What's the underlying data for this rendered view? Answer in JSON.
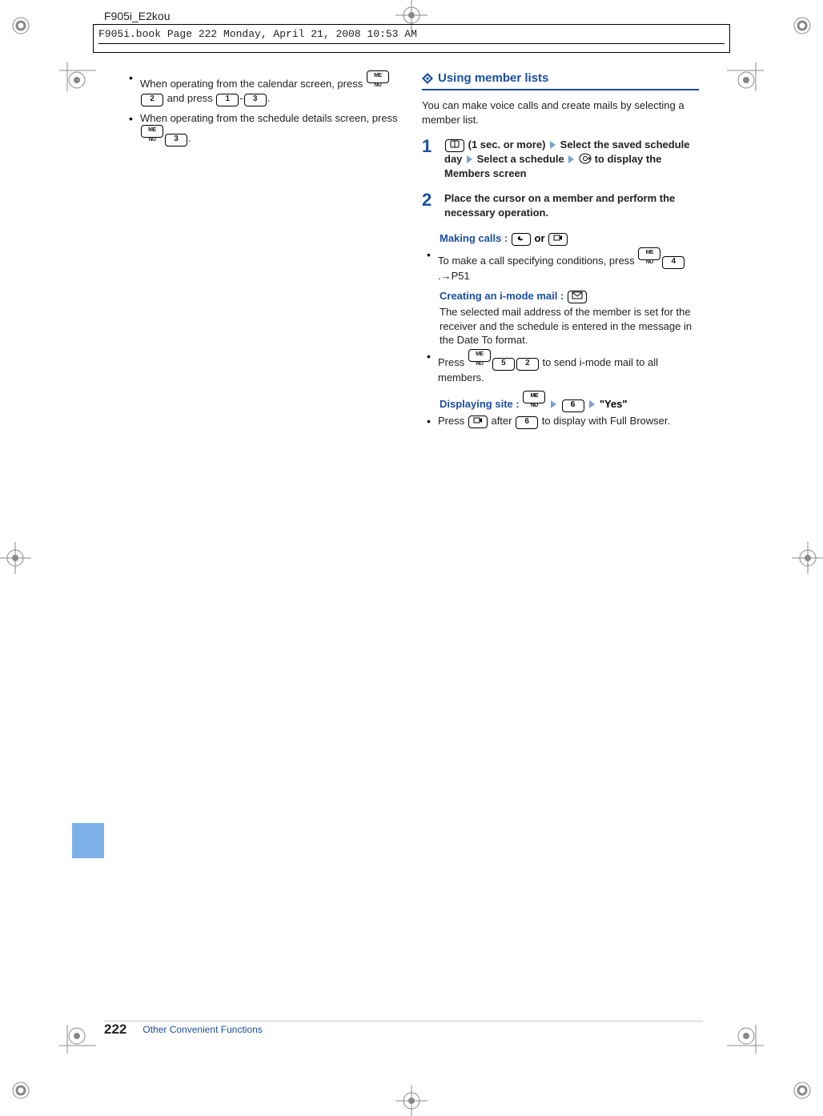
{
  "meta": {
    "doc_header": "F905i_E2kou",
    "framemaker": "F905i.book  Page 222  Monday, April 21, 2008  10:53 AM"
  },
  "left": {
    "b1_a": "When operating from the calendar screen, press ",
    "b1_b": " and press ",
    "b1_c": ".",
    "b2_a": "When operating from the schedule details screen, press ",
    "b2_b": "."
  },
  "right": {
    "section_title": "Using member lists",
    "intro": "You can make voice calls and create mails by selecting a member list.",
    "step1_a": " (1 sec. or more) ",
    "step1_b": " Select the saved schedule day ",
    "step1_c": " Select a schedule ",
    "step1_d": " to display the Members screen",
    "step2": "Place the cursor on a member and perform the necessary operation.",
    "making_label": "Making calls : ",
    "making_mid": " or ",
    "making_b1": "To make a call specifying conditions, press ",
    "making_b1_suffix": ".→P51",
    "imode_label": "Creating an i-mode mail : ",
    "imode_text": "The selected mail address of the member is set for the receiver and the schedule is entered in the message in the Date To format.",
    "imode_b1_a": "Press ",
    "imode_b1_b": " to send i-mode mail to all members.",
    "site_label": "Displaying site : ",
    "site_yes": " \"Yes\"",
    "site_b1_a": "Press ",
    "site_b1_mid": " after ",
    "site_b1_b": " to display with Full Browser."
  },
  "keys": {
    "menu": "ME\nNU",
    "k1": "1",
    "k2": "2",
    "k3": "3",
    "k4": "4",
    "k5": "5",
    "k6": "6"
  },
  "footer": {
    "page": "222",
    "label": "Other Convenient Functions"
  }
}
